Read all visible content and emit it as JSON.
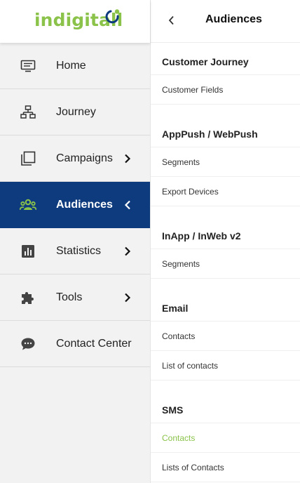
{
  "brand": {
    "name": "indigitall",
    "logo_color": "#8bc34a",
    "logo_mark_colors": [
      "#0e3b7e",
      "#8bc34a"
    ]
  },
  "sidebar": {
    "items": [
      {
        "label": "Home",
        "icon": "monitor-icon",
        "chevron": null,
        "active": false
      },
      {
        "label": "Journey",
        "icon": "sitemap-icon",
        "chevron": null,
        "active": false
      },
      {
        "label": "Campaigns",
        "icon": "copy-icon",
        "chevron": "right",
        "active": false
      },
      {
        "label": "Audiences",
        "icon": "users-icon",
        "chevron": "left",
        "active": true
      },
      {
        "label": "Statistics",
        "icon": "bar-chart-icon",
        "chevron": "right",
        "active": false
      },
      {
        "label": "Tools",
        "icon": "puzzle-icon",
        "chevron": "right",
        "active": false
      },
      {
        "label": "Contact Center",
        "icon": "chat-bubble-icon",
        "chevron": null,
        "active": false
      }
    ],
    "active_bg": "#0e3b7e",
    "active_icon_color": "#8bc34a"
  },
  "panel": {
    "title": "Audiences",
    "sections": [
      {
        "title": "Customer Journey",
        "items": [
          {
            "label": "Customer Fields",
            "selected": false
          }
        ]
      },
      {
        "title": "AppPush / WebPush",
        "items": [
          {
            "label": "Segments",
            "selected": false
          },
          {
            "label": "Export Devices",
            "selected": false
          }
        ]
      },
      {
        "title": "InApp / InWeb v2",
        "items": [
          {
            "label": "Segments",
            "selected": false
          }
        ]
      },
      {
        "title": "Email",
        "items": [
          {
            "label": "Contacts",
            "selected": false
          },
          {
            "label": "List of contacts",
            "selected": false
          }
        ]
      },
      {
        "title": "SMS",
        "items": [
          {
            "label": "Contacts",
            "selected": true
          },
          {
            "label": "Lists of Contacts",
            "selected": false
          }
        ]
      }
    ],
    "selected_color": "#8bc34a"
  }
}
